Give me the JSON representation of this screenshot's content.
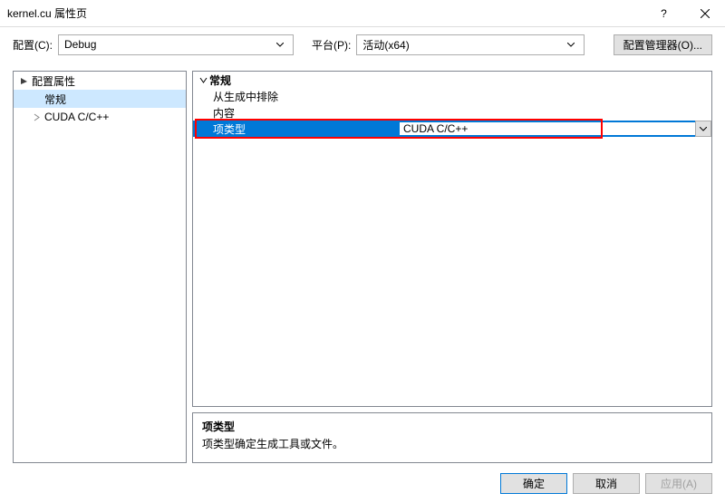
{
  "titlebar": {
    "title": "kernel.cu 属性页"
  },
  "toolbar": {
    "config_label": "配置(C):",
    "config_value": "Debug",
    "platform_label": "平台(P):",
    "platform_value": "活动(x64)",
    "mgr_label": "配置管理器(O)..."
  },
  "tree": {
    "root": "配置属性",
    "items": [
      "常规",
      "CUDA C/C++"
    ]
  },
  "props": {
    "group": "常规",
    "rows": [
      {
        "label": "从生成中排除",
        "value": ""
      },
      {
        "label": "内容",
        "value": ""
      },
      {
        "label": "项类型",
        "value": "CUDA C/C++"
      }
    ]
  },
  "desc": {
    "title": "项类型",
    "text": "项类型确定生成工具或文件。"
  },
  "footer": {
    "ok": "确定",
    "cancel": "取消",
    "apply": "应用(A)"
  }
}
